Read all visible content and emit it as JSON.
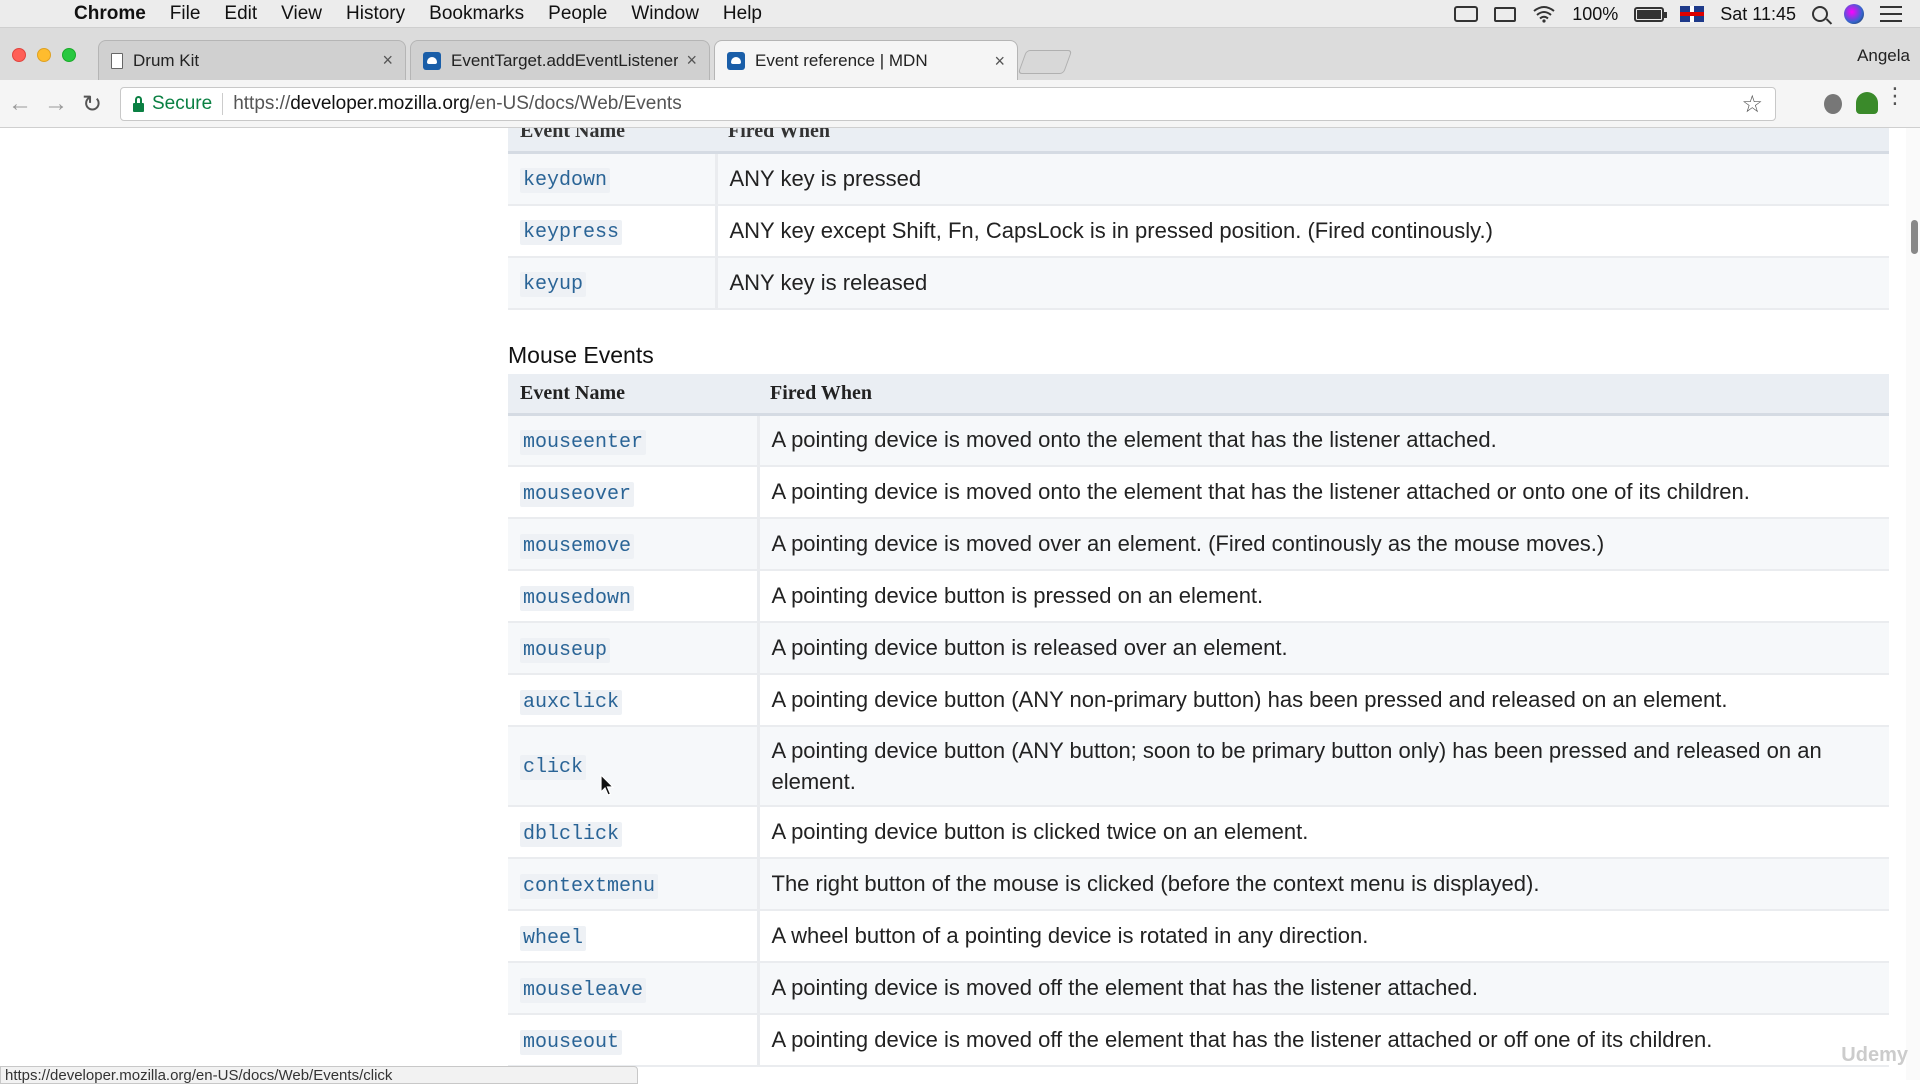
{
  "menubar": {
    "app_name": "Chrome",
    "items": [
      "File",
      "Edit",
      "View",
      "History",
      "Bookmarks",
      "People",
      "Window",
      "Help"
    ],
    "battery": "100%",
    "clock": "Sat 11:45"
  },
  "tabs": [
    {
      "title": "Drum Kit",
      "icon": "page-icon",
      "active": false
    },
    {
      "title": "EventTarget.addEventListener(",
      "icon": "mdn-icon",
      "active": false
    },
    {
      "title": "Event reference | MDN",
      "icon": "mdn-icon",
      "active": true
    }
  ],
  "profile_name": "Angela",
  "omnibox": {
    "secure_label": "Secure",
    "url_scheme": "https://",
    "url_host": "developer.mozilla.org",
    "url_path": "/en-US/docs/Web/Events"
  },
  "keyboard_table": {
    "header": [
      "Event Name",
      "Fired When"
    ],
    "rows": [
      {
        "name": "keydown",
        "desc": "ANY key is pressed"
      },
      {
        "name": "keypress",
        "desc": "ANY key except Shift, Fn, CapsLock is in pressed position. (Fired continously.)"
      },
      {
        "name": "keyup",
        "desc": "ANY key is released"
      }
    ]
  },
  "mouse_section_title": "Mouse Events",
  "mouse_table": {
    "header": [
      "Event Name",
      "Fired When"
    ],
    "rows": [
      {
        "name": "mouseenter",
        "desc": "A pointing device is moved onto the element that has the listener attached."
      },
      {
        "name": "mouseover",
        "desc": "A pointing device is moved onto the element that has the listener attached or onto one of its children."
      },
      {
        "name": "mousemove",
        "desc": "A pointing device is moved over an element. (Fired continously as the mouse moves.)"
      },
      {
        "name": "mousedown",
        "desc": "A pointing device button is pressed on an element."
      },
      {
        "name": "mouseup",
        "desc": "A pointing device button is released over an element."
      },
      {
        "name": "auxclick",
        "desc": "A pointing device button (ANY non-primary button) has been pressed and released on an element."
      },
      {
        "name": "click",
        "desc": "A pointing device button (ANY button; soon to be primary button only) has been pressed and released on an element."
      },
      {
        "name": "dblclick",
        "desc": "A pointing device button is clicked twice on an element."
      },
      {
        "name": "contextmenu",
        "desc": "The right button of the mouse is clicked (before the context menu is displayed)."
      },
      {
        "name": "wheel",
        "desc": "A wheel button of a pointing device is rotated in any direction."
      },
      {
        "name": "mouseleave",
        "desc": "A pointing device is moved off the element that has the listener attached."
      },
      {
        "name": "mouseout",
        "desc": "A pointing device is moved off the element that has the listener attached or off one of its children."
      }
    ]
  },
  "status_bubble": "https://developer.mozilla.org/en-US/docs/Web/Events/click",
  "watermark": "Udemy"
}
